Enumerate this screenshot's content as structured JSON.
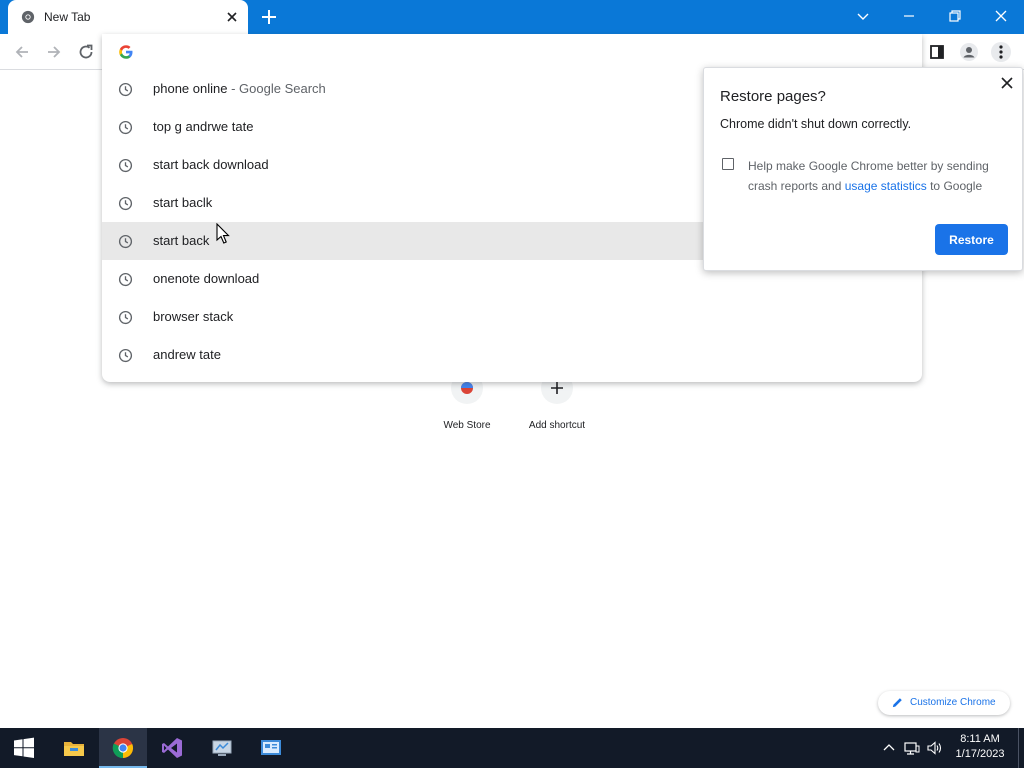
{
  "tab": {
    "title": "New Tab"
  },
  "window_controls": [
    "tab-search",
    "minimize",
    "restore",
    "close"
  ],
  "toolbar": {
    "omnibox_value": ""
  },
  "suggestions": [
    {
      "query": "phone online",
      "separator": " - ",
      "description": "Google Search"
    },
    {
      "query": "top g andrwe tate"
    },
    {
      "query": "start back download"
    },
    {
      "query": "start baclk"
    },
    {
      "query": "start back"
    },
    {
      "query": "onenote download"
    },
    {
      "query": "browser stack"
    },
    {
      "query": "andrew tate"
    }
  ],
  "shortcuts": [
    {
      "label": "Web Store"
    },
    {
      "label": "Add shortcut"
    }
  ],
  "restore_dialog": {
    "title": "Restore pages?",
    "message": "Chrome didn't shut down correctly.",
    "checkbox_text_before": "Help make Google Chrome better by sending crash reports and ",
    "checkbox_link": "usage statistics",
    "checkbox_text_after": " to Google",
    "checkbox_checked": false,
    "button_label": "Restore"
  },
  "customize": {
    "label": "Customize Chrome"
  },
  "taskbar": {
    "time": "8:11 AM",
    "date": "1/17/2023",
    "apps": [
      "start-icon",
      "file-explorer-icon",
      "chrome-icon",
      "visual-studio-icon",
      "desktop-app-icon",
      "control-panel-icon"
    ]
  },
  "colors": {
    "titlebar": "#0a78d7",
    "accent": "#1a73e8",
    "taskbar": "#121a28",
    "highlight_row": "#e8e8e8"
  }
}
